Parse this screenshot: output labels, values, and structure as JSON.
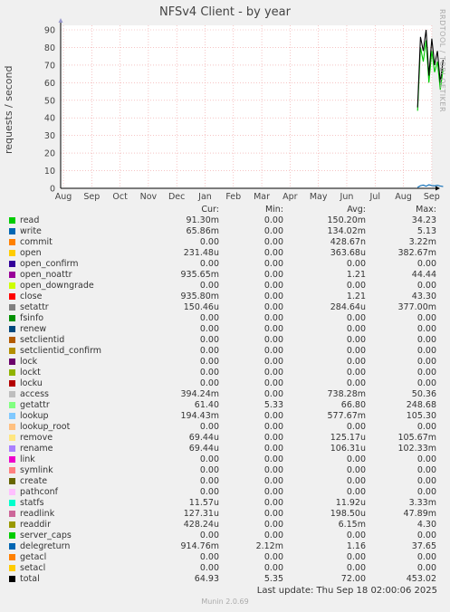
{
  "chart_data": {
    "type": "line",
    "title": "NFSv4 Client - by year",
    "ylabel": "requests / second",
    "ylim": [
      0,
      90
    ],
    "yticks": [
      0,
      10,
      20,
      30,
      40,
      50,
      60,
      70,
      80,
      90
    ],
    "xticks": [
      "Aug",
      "Sep",
      "Oct",
      "Nov",
      "Dec",
      "Jan",
      "Feb",
      "Mar",
      "Apr",
      "May",
      "Jun",
      "Jul",
      "Aug",
      "Sep"
    ],
    "grid": true,
    "series": [
      {
        "name": "read",
        "color": "#00cc00",
        "x": [
          12.5,
          12.6,
          12.7,
          12.8,
          12.9,
          13.0,
          13.1,
          13.2,
          13.3,
          13.4
        ],
        "values": [
          44,
          80,
          72,
          84,
          60,
          78,
          66,
          72,
          56,
          68
        ]
      },
      {
        "name": "write",
        "color": "#0066b3",
        "x": [
          12.5,
          12.6,
          12.7,
          12.8,
          12.9,
          13.0,
          13.1,
          13.2,
          13.3,
          13.4
        ],
        "values": [
          0.5,
          1.5,
          1.8,
          1.2,
          2.0,
          1.6,
          1.4,
          1.7,
          1.3,
          1.0
        ]
      },
      {
        "name": "total",
        "color": "#000000",
        "x": [
          12.5,
          12.6,
          12.7,
          12.8,
          12.9,
          13.0,
          13.1,
          13.2,
          13.3,
          13.4
        ],
        "values": [
          46,
          86,
          78,
          90,
          64,
          85,
          70,
          78,
          60,
          73
        ]
      }
    ]
  },
  "side_label": "RRDTOOL / TOBI OETIKER",
  "legend": {
    "headers": [
      "Cur:",
      "Min:",
      "Avg:",
      "Max:"
    ],
    "rows": [
      {
        "name": "read",
        "color": "#00cc00",
        "cur": "91.30m",
        "min": "0.00",
        "avg": "150.20m",
        "max": "34.23"
      },
      {
        "name": "write",
        "color": "#0066b3",
        "cur": "65.86m",
        "min": "0.00",
        "avg": "134.02m",
        "max": "5.13"
      },
      {
        "name": "commit",
        "color": "#ff8000",
        "cur": "0.00",
        "min": "0.00",
        "avg": "428.67n",
        "max": "3.22m"
      },
      {
        "name": "open",
        "color": "#ffcc00",
        "cur": "231.48u",
        "min": "0.00",
        "avg": "363.68u",
        "max": "382.67m"
      },
      {
        "name": "open_confirm",
        "color": "#330099",
        "cur": "0.00",
        "min": "0.00",
        "avg": "0.00",
        "max": "0.00"
      },
      {
        "name": "open_noattr",
        "color": "#990099",
        "cur": "935.65m",
        "min": "0.00",
        "avg": "1.21",
        "max": "44.44"
      },
      {
        "name": "open_downgrade",
        "color": "#ccff00",
        "cur": "0.00",
        "min": "0.00",
        "avg": "0.00",
        "max": "0.00"
      },
      {
        "name": "close",
        "color": "#ff0000",
        "cur": "935.80m",
        "min": "0.00",
        "avg": "1.21",
        "max": "43.30"
      },
      {
        "name": "setattr",
        "color": "#808080",
        "cur": "150.46u",
        "min": "0.00",
        "avg": "284.64u",
        "max": "377.00m"
      },
      {
        "name": "fsinfo",
        "color": "#008f00",
        "cur": "0.00",
        "min": "0.00",
        "avg": "0.00",
        "max": "0.00"
      },
      {
        "name": "renew",
        "color": "#00487d",
        "cur": "0.00",
        "min": "0.00",
        "avg": "0.00",
        "max": "0.00"
      },
      {
        "name": "setclientid",
        "color": "#b35a00",
        "cur": "0.00",
        "min": "0.00",
        "avg": "0.00",
        "max": "0.00"
      },
      {
        "name": "setclientid_confirm",
        "color": "#b38f00",
        "cur": "0.00",
        "min": "0.00",
        "avg": "0.00",
        "max": "0.00"
      },
      {
        "name": "lock",
        "color": "#6b006b",
        "cur": "0.00",
        "min": "0.00",
        "avg": "0.00",
        "max": "0.00"
      },
      {
        "name": "lockt",
        "color": "#8fb300",
        "cur": "0.00",
        "min": "0.00",
        "avg": "0.00",
        "max": "0.00"
      },
      {
        "name": "locku",
        "color": "#b30000",
        "cur": "0.00",
        "min": "0.00",
        "avg": "0.00",
        "max": "0.00"
      },
      {
        "name": "access",
        "color": "#bebebe",
        "cur": "394.24m",
        "min": "0.00",
        "avg": "738.28m",
        "max": "50.36"
      },
      {
        "name": "getattr",
        "color": "#80ff80",
        "cur": "61.40",
        "min": "5.33",
        "avg": "66.80",
        "max": "248.68"
      },
      {
        "name": "lookup",
        "color": "#80c9ff",
        "cur": "194.43m",
        "min": "0.00",
        "avg": "577.67m",
        "max": "105.30"
      },
      {
        "name": "lookup_root",
        "color": "#ffc080",
        "cur": "0.00",
        "min": "0.00",
        "avg": "0.00",
        "max": "0.00"
      },
      {
        "name": "remove",
        "color": "#ffe680",
        "cur": "69.44u",
        "min": "0.00",
        "avg": "125.17u",
        "max": "105.67m"
      },
      {
        "name": "rename",
        "color": "#aa80ff",
        "cur": "69.44u",
        "min": "0.00",
        "avg": "106.31u",
        "max": "102.33m"
      },
      {
        "name": "link",
        "color": "#ee00cc",
        "cur": "0.00",
        "min": "0.00",
        "avg": "0.00",
        "max": "0.00"
      },
      {
        "name": "symlink",
        "color": "#ff8080",
        "cur": "0.00",
        "min": "0.00",
        "avg": "0.00",
        "max": "0.00"
      },
      {
        "name": "create",
        "color": "#666600",
        "cur": "0.00",
        "min": "0.00",
        "avg": "0.00",
        "max": "0.00"
      },
      {
        "name": "pathconf",
        "color": "#ffbfff",
        "cur": "0.00",
        "min": "0.00",
        "avg": "0.00",
        "max": "0.00"
      },
      {
        "name": "statfs",
        "color": "#00ffcc",
        "cur": "11.57u",
        "min": "0.00",
        "avg": "11.92u",
        "max": "3.33m"
      },
      {
        "name": "readlink",
        "color": "#cc6699",
        "cur": "127.31u",
        "min": "0.00",
        "avg": "198.50u",
        "max": "47.89m"
      },
      {
        "name": "readdir",
        "color": "#999900",
        "cur": "428.24u",
        "min": "0.00",
        "avg": "6.15m",
        "max": "4.30"
      },
      {
        "name": "server_caps",
        "color": "#00cc00",
        "cur": "0.00",
        "min": "0.00",
        "avg": "0.00",
        "max": "0.00"
      },
      {
        "name": "delegreturn",
        "color": "#0066b3",
        "cur": "914.76m",
        "min": "2.12m",
        "avg": "1.16",
        "max": "37.65"
      },
      {
        "name": "getacl",
        "color": "#ff8000",
        "cur": "0.00",
        "min": "0.00",
        "avg": "0.00",
        "max": "0.00"
      },
      {
        "name": "setacl",
        "color": "#ffcc00",
        "cur": "0.00",
        "min": "0.00",
        "avg": "0.00",
        "max": "0.00"
      },
      {
        "name": "total",
        "color": "#000000",
        "cur": "64.93",
        "min": "5.35",
        "avg": "72.00",
        "max": "453.02"
      }
    ]
  },
  "last_update": "Last update: Thu Sep 18 02:00:06 2025",
  "footer": "Munin 2.0.69"
}
